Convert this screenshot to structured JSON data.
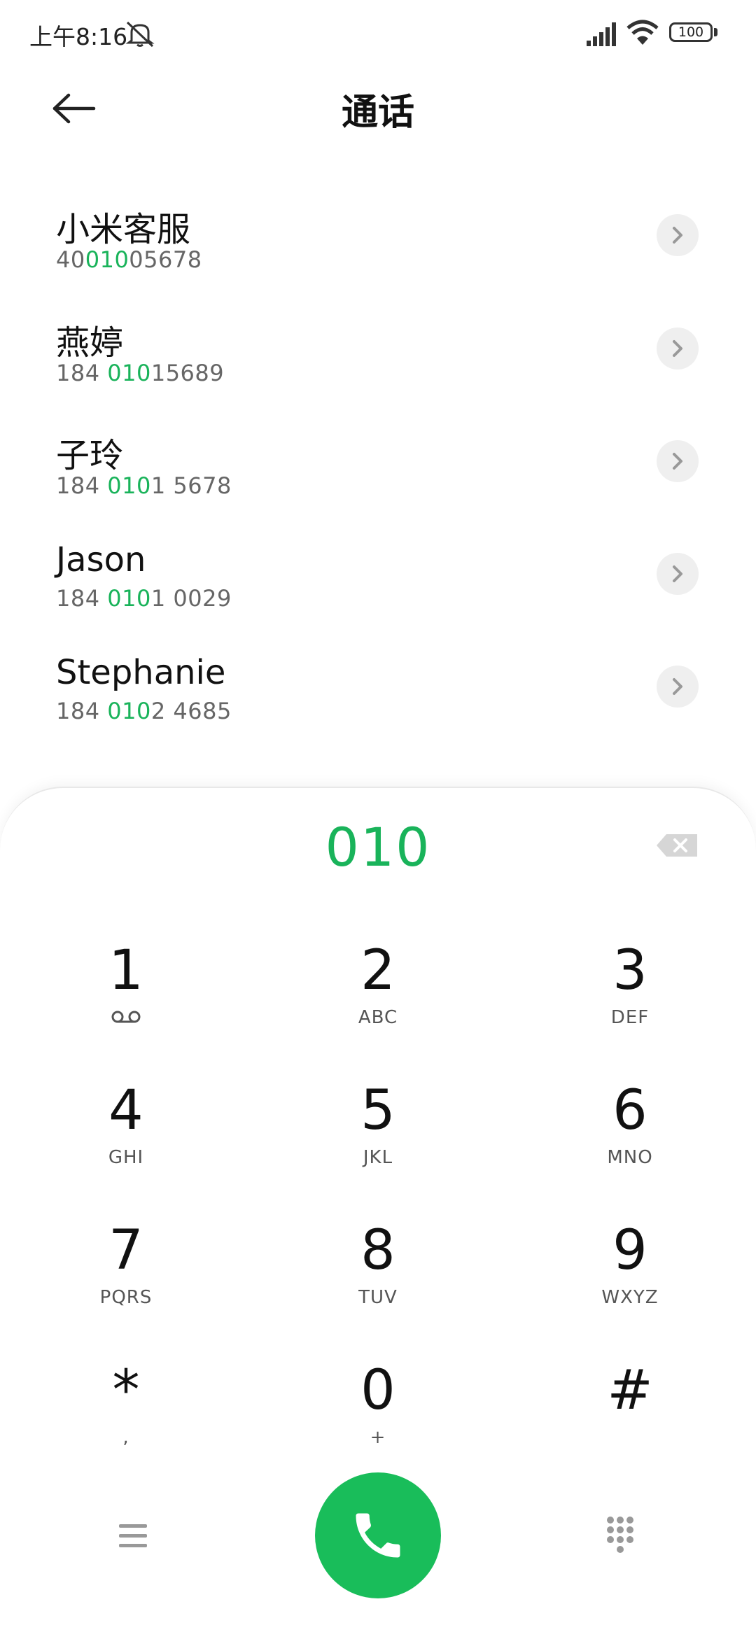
{
  "status_bar": {
    "time": "上午8:16",
    "battery": "100"
  },
  "header": {
    "title": "通话"
  },
  "results": [
    {
      "name": "小米客服",
      "number_parts": [
        "40",
        "010",
        "05678"
      ]
    },
    {
      "name": "燕婷",
      "number_parts": [
        "184 ",
        "010",
        "15689"
      ]
    },
    {
      "name": "子玲",
      "number_parts": [
        "184 ",
        "010",
        "1 5678"
      ]
    },
    {
      "name": "Jason",
      "number_parts": [
        "184 ",
        "010",
        "1 0029"
      ]
    },
    {
      "name": "Stephanie",
      "number_parts": [
        "184 ",
        "010",
        "2 4685"
      ]
    }
  ],
  "dialpad": {
    "input": "010",
    "keys": [
      {
        "digit": "1",
        "letters": "",
        "icon": "voicemail-icon"
      },
      {
        "digit": "2",
        "letters": "ABC"
      },
      {
        "digit": "3",
        "letters": "DEF"
      },
      {
        "digit": "4",
        "letters": "GHI"
      },
      {
        "digit": "5",
        "letters": "JKL"
      },
      {
        "digit": "6",
        "letters": "MNO"
      },
      {
        "digit": "7",
        "letters": "PQRS"
      },
      {
        "digit": "8",
        "letters": "TUV"
      },
      {
        "digit": "9",
        "letters": "WXYZ"
      },
      {
        "digit": "*",
        "letters": ","
      },
      {
        "digit": "0",
        "letters": "+"
      },
      {
        "digit": "#",
        "letters": ""
      }
    ]
  },
  "colors": {
    "accent": "#19b35a",
    "call_button": "#19bd5a"
  },
  "icons": [
    "mute-icon",
    "signal-icon",
    "wifi-icon",
    "battery-icon",
    "back-arrow-icon",
    "chevron-right-icon",
    "backspace-icon",
    "voicemail-icon",
    "menu-icon",
    "phone-icon",
    "dialpad-icon"
  ]
}
